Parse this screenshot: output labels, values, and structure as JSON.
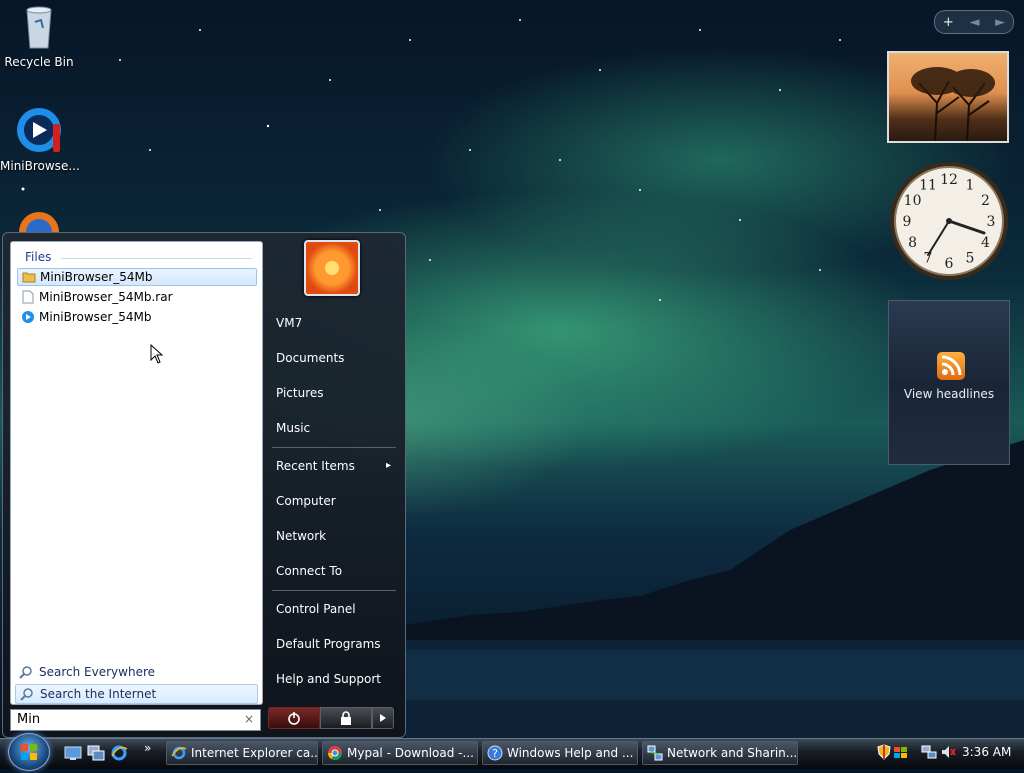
{
  "desktop": {
    "icons": [
      {
        "label": "Recycle Bin"
      },
      {
        "label": "MiniBrowse..."
      }
    ]
  },
  "sidebar": {
    "controls": [
      "+",
      "◄",
      "►"
    ],
    "clock": {
      "numerals": [
        "12",
        "1",
        "2",
        "3",
        "4",
        "5",
        "6",
        "7",
        "8",
        "9",
        "10",
        "11"
      ]
    },
    "feed_label": "View headlines"
  },
  "start_menu": {
    "files_heading": "Files",
    "files": [
      {
        "name": "MiniBrowser_54Mb",
        "icon": "folder-icon",
        "selected": true
      },
      {
        "name": "MiniBrowser_54Mb.rar",
        "icon": "document-icon",
        "selected": false
      },
      {
        "name": "MiniBrowser_54Mb",
        "icon": "minibrowser-app-icon",
        "selected": false
      }
    ],
    "search_everywhere": "Search Everywhere",
    "search_internet": "Search the Internet",
    "search_value": "Min",
    "search_clear": "×",
    "right_items": [
      "VM7",
      "Documents",
      "Pictures",
      "Music",
      "Recent Items",
      "Computer",
      "Network",
      "Connect To",
      "Control Panel",
      "Default Programs",
      "Help and Support"
    ],
    "recent_arrow": "▸"
  },
  "taskbar": {
    "quicklaunch_more": "»",
    "buttons": [
      {
        "label": "Internet Explorer ca...",
        "icon": "ie-icon"
      },
      {
        "label": "Mypal - Download -...",
        "icon": "chrome-icon"
      },
      {
        "label": "Windows Help and ...",
        "icon": "help-icon"
      },
      {
        "label": "Network and Sharin...",
        "icon": "network-icon"
      }
    ],
    "clock": "3:36 AM"
  }
}
